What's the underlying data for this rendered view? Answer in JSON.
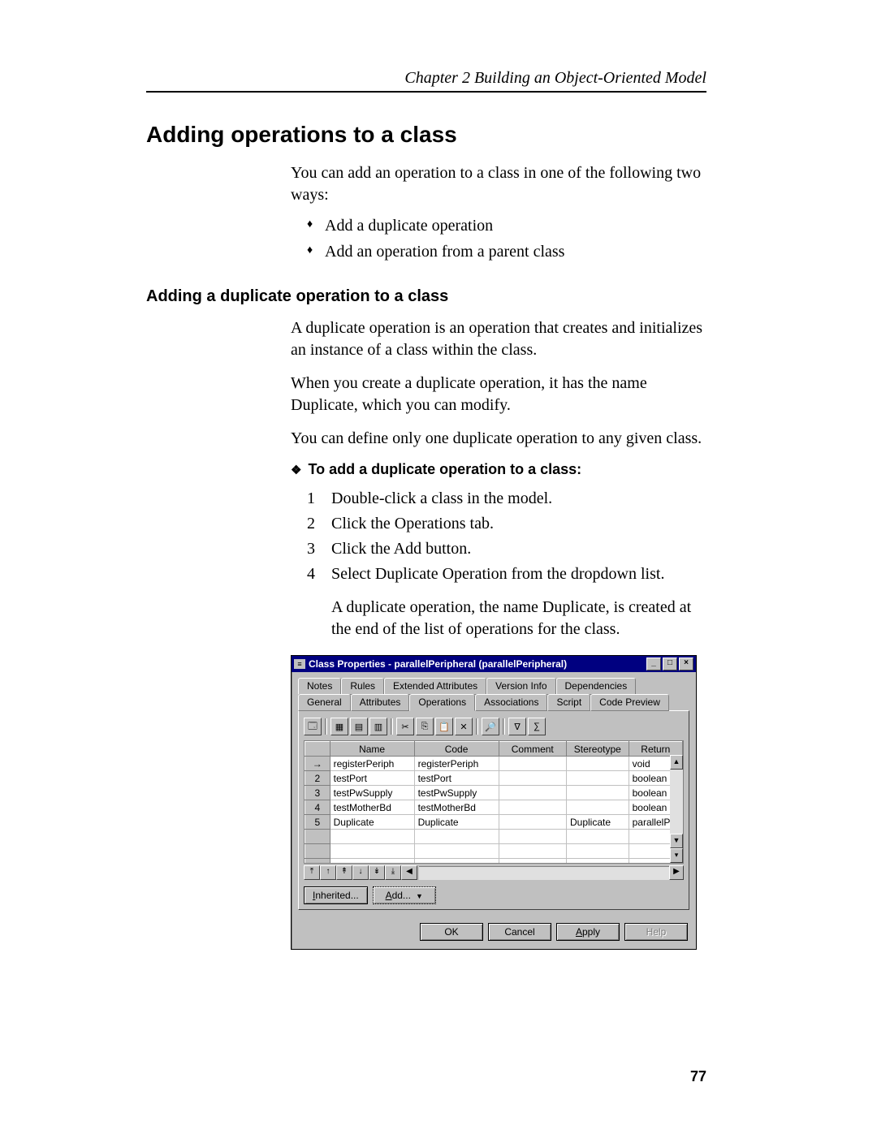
{
  "chapter_header": "Chapter 2  Building an Object-Oriented Model",
  "section_title": "Adding operations to a class",
  "intro": "You can add an operation to a class in one of the following two ways:",
  "intro_bullets": [
    "Add a duplicate operation",
    "Add an operation from a parent class"
  ],
  "subsection_title": "Adding a duplicate operation to a class",
  "para1": "A duplicate operation is an operation that creates and initializes an instance of a class within the class.",
  "para2": "When you create a duplicate operation, it has the name Duplicate, which you can modify.",
  "para3": "You can define only one duplicate operation to any given class.",
  "task_title": "To add a duplicate operation to a class:",
  "steps": [
    "Double-click a class in the model.",
    "Click the Operations tab.",
    "Click the Add button.",
    "Select Duplicate Operation from the dropdown list."
  ],
  "result": "A duplicate operation, the name Duplicate, is created at the end of the list of operations for the class.",
  "page_number": "77",
  "dialog": {
    "title": "Class Properties - parallelPeripheral (parallelPeripheral)",
    "tabs_row1": [
      "Notes",
      "Rules",
      "Extended Attributes",
      "Version Info",
      "Dependencies"
    ],
    "tabs_row2": [
      "General",
      "Attributes",
      "Operations",
      "Associations",
      "Script",
      "Code Preview"
    ],
    "active_tab": "Operations",
    "columns": [
      "",
      "Name",
      "Code",
      "Comment",
      "Stereotype",
      "Return"
    ],
    "rows": [
      {
        "idx": "→",
        "name": "registerPeriph",
        "code": "registerPeriph",
        "comment": "",
        "stereotype": "",
        "return": "void"
      },
      {
        "idx": "2",
        "name": "testPort",
        "code": "testPort",
        "comment": "",
        "stereotype": "",
        "return": "boolean"
      },
      {
        "idx": "3",
        "name": "testPwSupply",
        "code": "testPwSupply",
        "comment": "",
        "stereotype": "",
        "return": "boolean"
      },
      {
        "idx": "4",
        "name": "testMotherBd",
        "code": "testMotherBd",
        "comment": "",
        "stereotype": "",
        "return": "boolean"
      },
      {
        "idx": "5",
        "name": "Duplicate",
        "code": "Duplicate",
        "comment": "",
        "stereotype": "Duplicate",
        "return": "parallelPer"
      }
    ],
    "buttons": {
      "inherited": "Inherited...",
      "add": "Add...",
      "ok": "OK",
      "cancel": "Cancel",
      "apply": "Apply",
      "help": "Help"
    }
  }
}
